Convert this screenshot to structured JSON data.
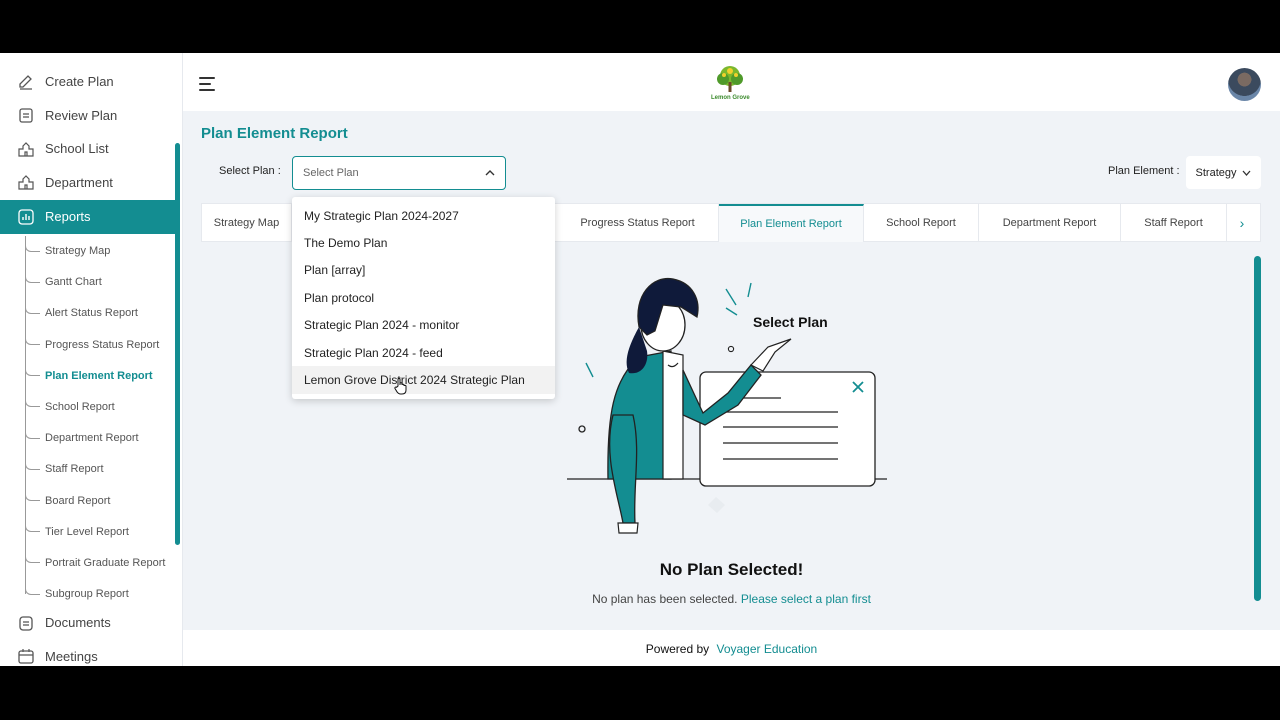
{
  "sidebar": {
    "top_items": [
      {
        "label": "Create Plan",
        "icon": "pencil-icon"
      },
      {
        "label": "Review Plan",
        "icon": "clipboard-icon"
      },
      {
        "label": "School List",
        "icon": "school-icon"
      },
      {
        "label": "Department",
        "icon": "building-icon"
      },
      {
        "label": "Reports",
        "icon": "report-icon"
      }
    ],
    "sub_items": [
      "Strategy Map",
      "Gantt Chart",
      "Alert Status Report",
      "Progress Status Report",
      "Plan Element Report",
      "School Report",
      "Department Report",
      "Staff Report",
      "Board Report",
      "Tier Level Report",
      "Portrait Graduate Report",
      "Subgroup Report"
    ],
    "active_sub": "Plan Element Report",
    "bottom_items": [
      {
        "label": "Documents",
        "icon": "document-icon"
      },
      {
        "label": "Meetings",
        "icon": "calendar-icon"
      }
    ]
  },
  "header": {
    "logo_text": "Lemon Grove"
  },
  "page": {
    "title": "Plan Element Report",
    "select_plan_label": "Select Plan :",
    "select_plan_placeholder": "Select Plan",
    "plan_element_label": "Plan Element :",
    "plan_element_value": "Strategy"
  },
  "tabs": [
    {
      "label": "Strategy Map"
    },
    {
      "label": "Progress Status Report"
    },
    {
      "label": "Plan Element Report",
      "active": true
    },
    {
      "label": "School Report"
    },
    {
      "label": "Department Report"
    },
    {
      "label": "Staff Report"
    }
  ],
  "dropdown": {
    "options": [
      "My Strategic Plan 2024-2027",
      "The Demo Plan",
      "Plan [array]",
      "Plan protocol",
      "Strategic Plan 2024 - monitor",
      "Strategic Plan 2024 - feed",
      "Lemon Grove District 2024 Strategic Plan"
    ],
    "hovered": "Lemon Grove District 2024 Strategic Plan"
  },
  "empty_state": {
    "illustration_text": "Select Plan",
    "title": "No Plan Selected!",
    "description": "No plan has been selected.",
    "link": "Please select a plan first"
  },
  "footer": {
    "powered_by": "Powered by",
    "company": "Voyager Education"
  },
  "colors": {
    "accent": "#138d91",
    "background": "#f0f3f7"
  }
}
